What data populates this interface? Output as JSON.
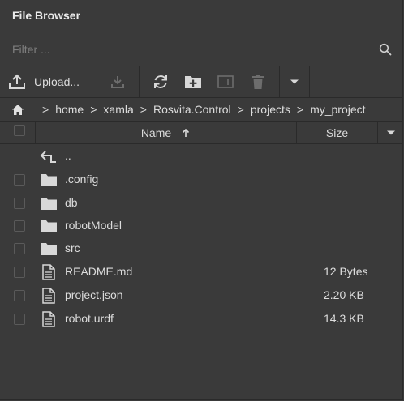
{
  "panel": {
    "title": "File Browser"
  },
  "filter": {
    "placeholder": "Filter ..."
  },
  "toolbar": {
    "upload_label": "Upload..."
  },
  "breadcrumb": {
    "separator": ">",
    "items": [
      "home",
      "xamla",
      "Rosvita.Control",
      "projects",
      "my_project"
    ]
  },
  "table": {
    "name_header": "Name",
    "size_header": "Size",
    "rows": [
      {
        "name": "..",
        "size": ""
      },
      {
        "name": ".config",
        "size": ""
      },
      {
        "name": "db",
        "size": ""
      },
      {
        "name": "robotModel",
        "size": ""
      },
      {
        "name": "src",
        "size": ""
      },
      {
        "name": "README.md",
        "size": "12 Bytes"
      },
      {
        "name": "project.json",
        "size": "2.20 KB"
      },
      {
        "name": "robot.urdf",
        "size": "14.3 KB"
      }
    ]
  }
}
